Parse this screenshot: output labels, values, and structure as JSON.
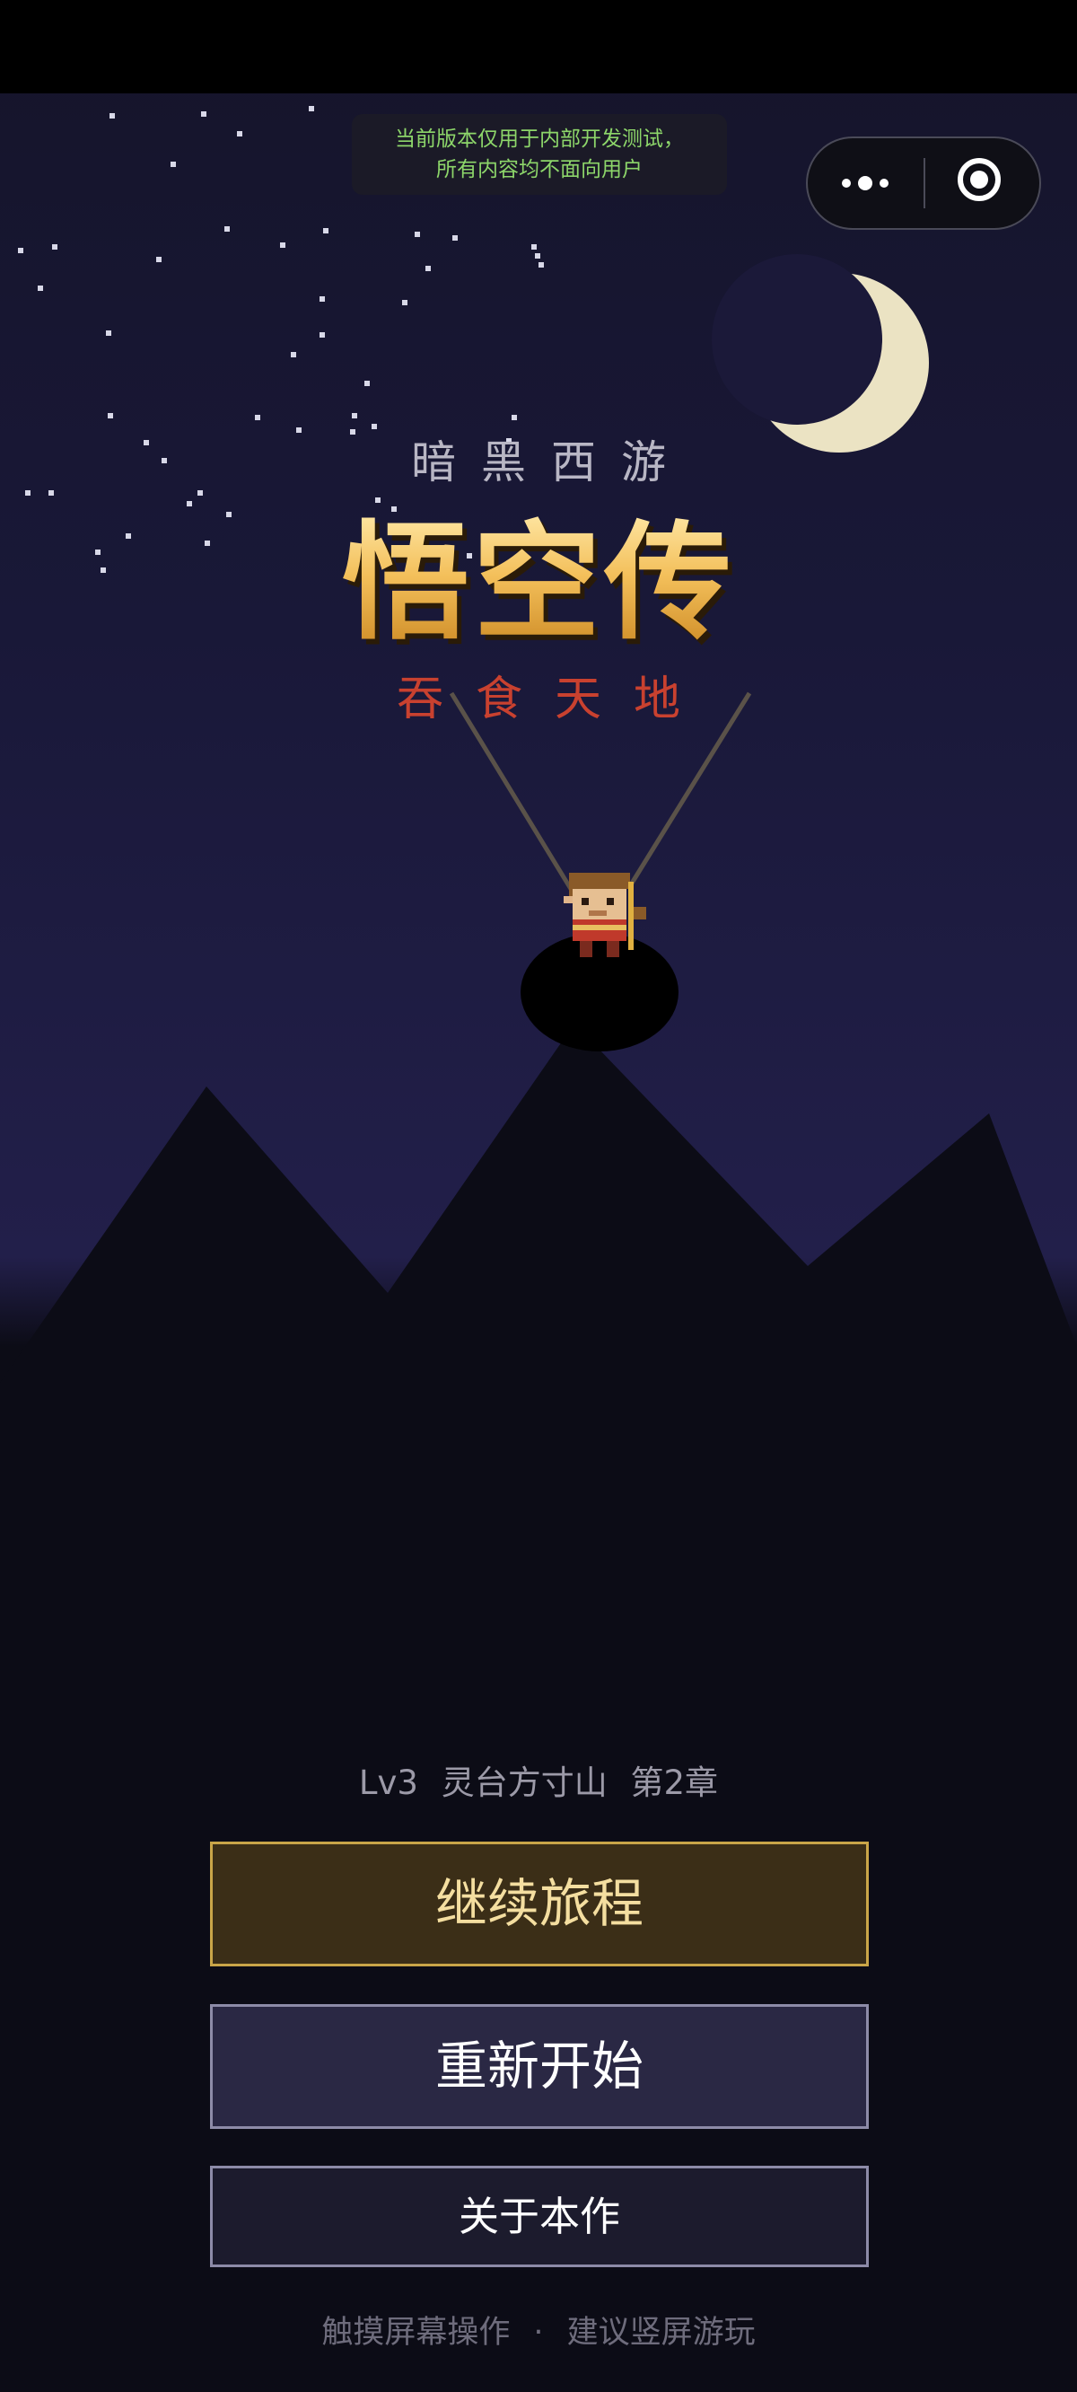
{
  "notice": {
    "line1": "当前版本仅用于内部开发测试，",
    "line2": "所有内容均不面向用户"
  },
  "capsule": {
    "more_icon": "more-dots-icon",
    "close_icon": "target-close-icon"
  },
  "title": {
    "subtitle_top": "暗黑西游",
    "main": "悟空传",
    "subtitle_red": "吞食天地"
  },
  "progress": {
    "level": "Lv3",
    "location": "灵台方寸山",
    "chapter": "第2章"
  },
  "buttons": {
    "continue_label": "继续旅程",
    "restart_label": "重新开始",
    "about_label": "关于本作"
  },
  "footer": {
    "hint_left": "触摸屏幕操作",
    "separator": "·",
    "hint_right": "建议竖屏游玩"
  },
  "colors": {
    "title_gold": "#f3bf5a",
    "subtitle_red": "#c9412f",
    "continue_border": "#c9a548",
    "notice_green": "#8dd66a"
  }
}
